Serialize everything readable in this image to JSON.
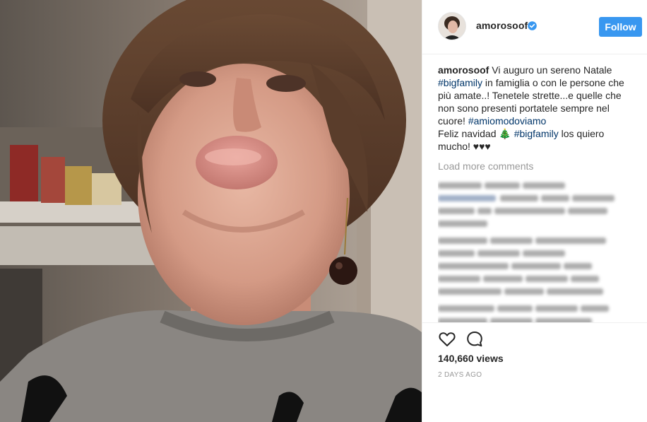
{
  "post": {
    "username": "amorosoof",
    "follow_label": "Follow",
    "caption": {
      "user": "amorosoof",
      "t1": " Vi auguro un sereno Natale ",
      "tag1": "#bigfamily",
      "t2": " in famiglia o con le persone che più amate..! Tenetele strette...e quelle che non sono presenti portatele sempre nel cuore! ",
      "tag2": "#amiomodoviamo",
      "t3": "Feliz navidad 🎄 ",
      "tag3": "#bigfamily",
      "t4": " los quiero mucho! ♥♥♥"
    },
    "load_more": "Load more comments",
    "views": "140,660 views",
    "timestamp": "2 DAYS AGO"
  },
  "colors": {
    "follow_button": "#3897f0",
    "hashtag": "#003569",
    "muted": "#999999",
    "text": "#262626",
    "verified_badge": "#3897f0"
  },
  "icons": {
    "verified": "verified-badge-icon",
    "like": "heart-outline-icon",
    "comment": "speech-bubble-icon"
  }
}
